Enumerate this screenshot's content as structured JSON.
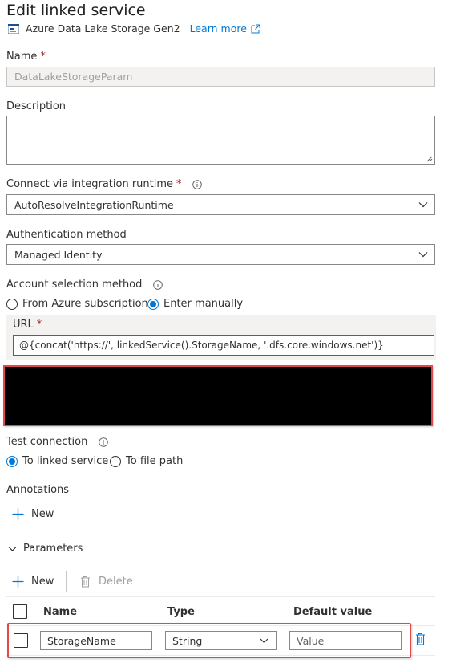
{
  "header": {
    "title": "Edit linked service",
    "service_type": "Azure Data Lake Storage Gen2",
    "learn_more": "Learn more"
  },
  "name_field": {
    "label": "Name",
    "required_mark": "*",
    "value": "DataLakeStorageParam"
  },
  "description_field": {
    "label": "Description",
    "value": ""
  },
  "runtime_field": {
    "label": "Connect via integration runtime",
    "required_mark": "*",
    "value": "AutoResolveIntegrationRuntime"
  },
  "auth_field": {
    "label": "Authentication method",
    "value": "Managed Identity"
  },
  "account_selection": {
    "label": "Account selection method",
    "options": [
      {
        "label": "From Azure subscription",
        "checked": false
      },
      {
        "label": "Enter manually",
        "checked": true
      }
    ]
  },
  "url_field": {
    "label": "URL",
    "required_mark": "*",
    "value": "@{concat('https://', linkedService().StorageName, '.dfs.core.windows.net')}"
  },
  "test_connection": {
    "label": "Test connection",
    "options": [
      {
        "label": "To linked service",
        "checked": true
      },
      {
        "label": "To file path",
        "checked": false
      }
    ]
  },
  "annotations": {
    "label": "Annotations",
    "new_label": "New"
  },
  "parameters": {
    "label": "Parameters",
    "new_label": "New",
    "delete_label": "Delete",
    "columns": {
      "name": "Name",
      "type": "Type",
      "default": "Default value"
    },
    "rows": [
      {
        "name": "StorageName",
        "type": "String",
        "default_placeholder": "Value"
      }
    ]
  },
  "colors": {
    "accent": "#0078d4",
    "highlight": "#e04a4a",
    "required": "#a4262c"
  }
}
